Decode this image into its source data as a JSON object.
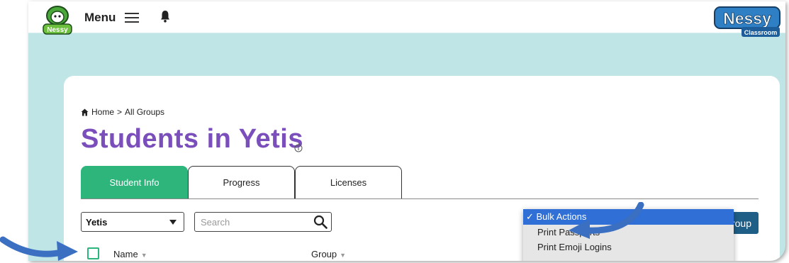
{
  "header": {
    "menu_label": "Menu",
    "logo_text": "Nessy",
    "brand_main": "Nessy",
    "brand_sub": "Classroom"
  },
  "breadcrumb": {
    "home": "Home",
    "separator": ">",
    "current": "All Groups"
  },
  "page": {
    "title": "Students in Yetis"
  },
  "tabs": [
    {
      "label": "Student Info",
      "active": true
    },
    {
      "label": "Progress",
      "active": false
    },
    {
      "label": "Licenses",
      "active": false
    }
  ],
  "filters": {
    "group_value": "Yetis",
    "search_placeholder": "Search"
  },
  "bulk_actions": {
    "selected": "✓ Bulk Actions",
    "options": [
      "Print Passports",
      "Print Emoji Logins"
    ]
  },
  "assign_button": "nts to Group",
  "table": {
    "columns": [
      "Name",
      "Group"
    ]
  },
  "colors": {
    "accent_purple": "#7a4ebb",
    "tab_green": "#2db57c",
    "button_blue": "#1f5e86",
    "background_teal": "#bfe5e6",
    "dropdown_highlight": "#2f6fd6",
    "arrow_blue": "#3b6fc1"
  },
  "icons": [
    "hamburger-icon",
    "bell-icon",
    "home-icon",
    "info-icon",
    "search-icon",
    "chevron-down-icon",
    "sort-icon"
  ]
}
